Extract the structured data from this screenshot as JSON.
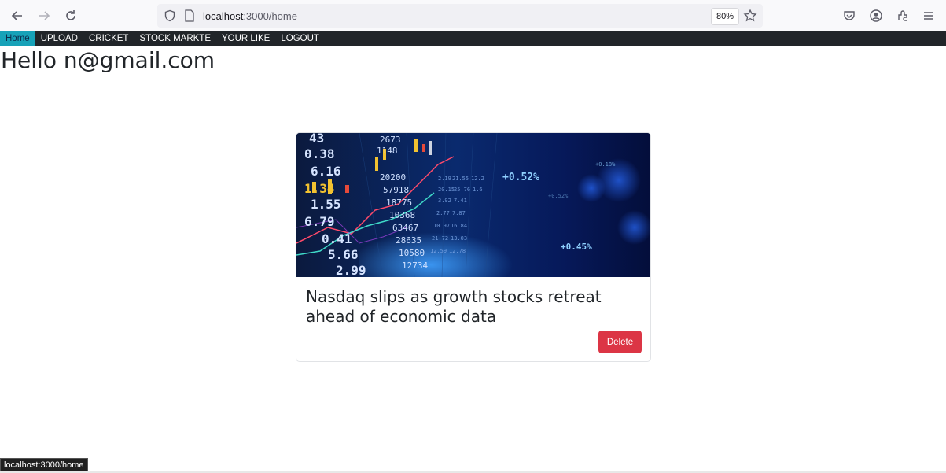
{
  "browser": {
    "back_icon": "arrow-left-icon",
    "forward_icon": "arrow-right-icon",
    "reload_icon": "reload-icon",
    "shield_icon": "shield-icon",
    "page_icon": "page-icon",
    "url_host": "localhost",
    "url_rest": ":3000/home",
    "zoom": "80%",
    "bookmark_icon": "star-icon",
    "pocket_icon": "pocket-icon",
    "account_icon": "account-icon",
    "extensions_icon": "extensions-icon",
    "menu_icon": "hamburger-menu-icon",
    "status_url": "localhost:3000/home"
  },
  "nav": {
    "items": [
      {
        "label": "Home",
        "active": true
      },
      {
        "label": "UPLOAD",
        "active": false
      },
      {
        "label": "CRICKET",
        "active": false
      },
      {
        "label": "STOCK MARKTE",
        "active": false
      },
      {
        "label": "YOUR LIKE",
        "active": false
      },
      {
        "label": "LOGOUT",
        "active": false
      }
    ]
  },
  "main": {
    "greeting": "Hello n@gmail.com",
    "card": {
      "image_ticker_values": [
        "43",
        "0.38",
        "6.16",
        "1.34",
        "1.55",
        "6.79",
        "0.41",
        "5.66",
        "2.99",
        "2673",
        "1148",
        "20200",
        "57918",
        "18775",
        "10368",
        "63467",
        "28635",
        "10580",
        "12734",
        "+0.52%",
        "+0.45%"
      ],
      "title": "Nasdaq slips as growth stocks retreat ahead of economic data",
      "delete_label": "Delete"
    }
  },
  "colors": {
    "nav_bg": "#212529",
    "nav_active": "#17a2b8",
    "delete_button": "#dc3545"
  }
}
